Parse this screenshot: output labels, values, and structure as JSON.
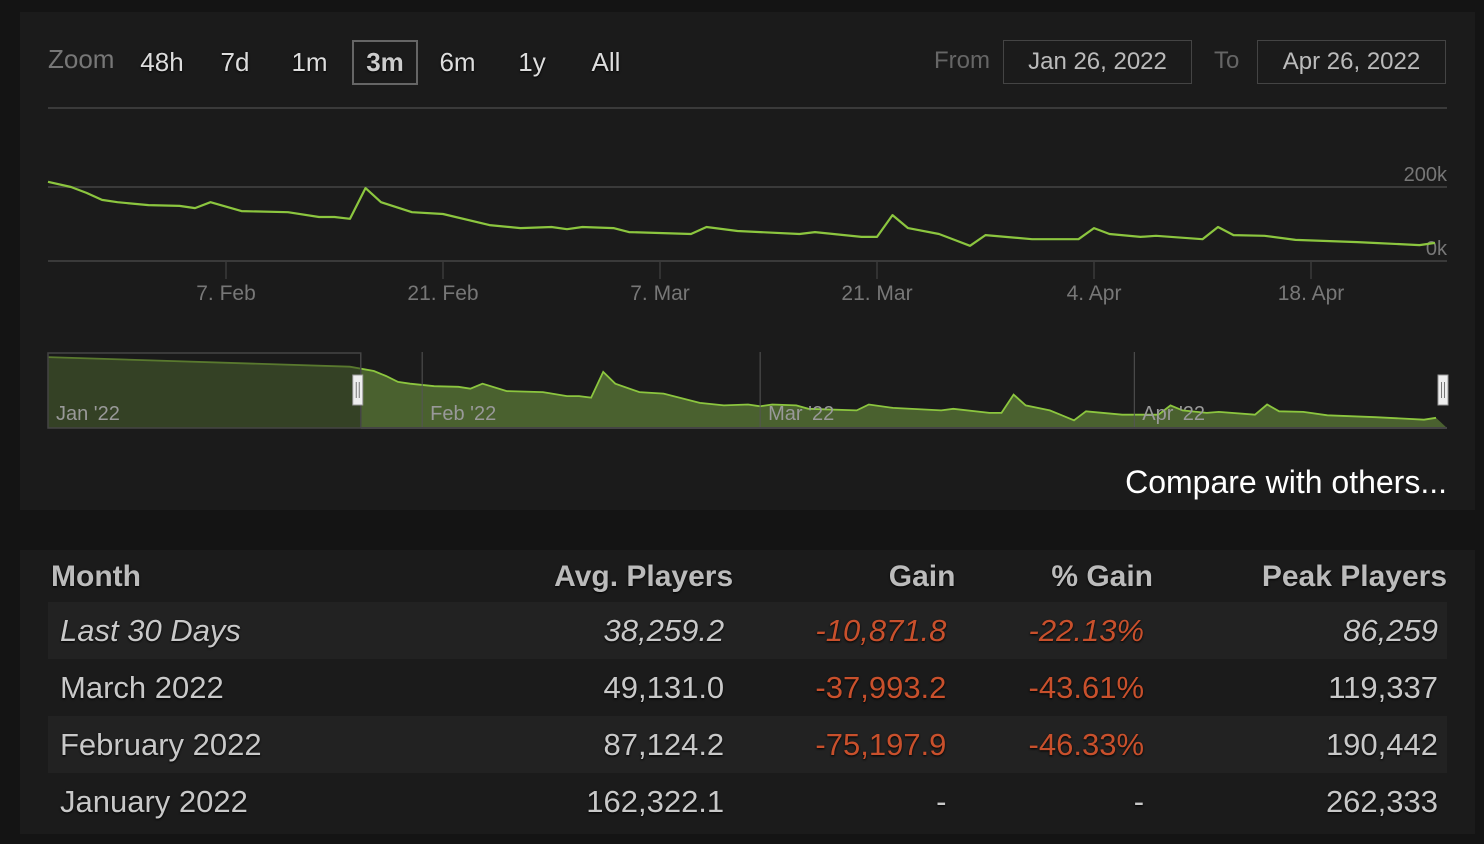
{
  "toolbar": {
    "zoom_label": "Zoom",
    "ranges": [
      "48h",
      "7d",
      "1m",
      "3m",
      "6m",
      "1y",
      "All"
    ],
    "selected_range": "3m",
    "from_label": "From",
    "from_value": "Jan 26, 2022",
    "to_label": "To",
    "to_value": "Apr 26, 2022"
  },
  "compare_link": "Compare with others...",
  "colors": {
    "line": "#8cc63f",
    "area": "#4a612f",
    "area_masked": "#2e3a22",
    "negative": "#c8502c"
  },
  "chart_data": {
    "type": "line",
    "title": "",
    "xlabel": "",
    "ylabel": "",
    "x_range": [
      "2022-01-26",
      "2022-04-26"
    ],
    "ylim": [
      0,
      200000
    ],
    "y_ticks": [
      {
        "value": 200000,
        "label": "200k"
      },
      {
        "value": 0,
        "label": "0k"
      }
    ],
    "x_ticks": [
      {
        "date": "2022-02-07",
        "label": "7. Feb"
      },
      {
        "date": "2022-02-21",
        "label": "21. Feb"
      },
      {
        "date": "2022-03-07",
        "label": "7. Mar"
      },
      {
        "date": "2022-03-21",
        "label": "21. Mar"
      },
      {
        "date": "2022-04-04",
        "label": "4. Apr"
      },
      {
        "date": "2022-04-18",
        "label": "18. Apr"
      }
    ],
    "grid": true,
    "series": [
      {
        "values": [
          [
            "2022-01-26",
            214000
          ],
          [
            "2022-01-28",
            200000
          ],
          [
            "2022-01-29",
            184000
          ],
          [
            "2022-01-30",
            165000
          ],
          [
            "2022-01-31",
            159000
          ],
          [
            "2022-02-02",
            151000
          ],
          [
            "2022-02-04",
            149000
          ],
          [
            "2022-02-05",
            143000
          ],
          [
            "2022-02-06",
            159000
          ],
          [
            "2022-02-08",
            135000
          ],
          [
            "2022-02-11",
            132000
          ],
          [
            "2022-02-13",
            119000
          ],
          [
            "2022-02-14",
            119000
          ],
          [
            "2022-02-15",
            114000
          ],
          [
            "2022-02-16",
            197000
          ],
          [
            "2022-02-17",
            159000
          ],
          [
            "2022-02-19",
            132000
          ],
          [
            "2022-02-21",
            127000
          ],
          [
            "2022-02-24",
            97000
          ],
          [
            "2022-02-26",
            89000
          ],
          [
            "2022-02-28",
            92000
          ],
          [
            "2022-03-01",
            86000
          ],
          [
            "2022-03-02",
            92000
          ],
          [
            "2022-03-04",
            89000
          ],
          [
            "2022-03-05",
            78000
          ],
          [
            "2022-03-09",
            73000
          ],
          [
            "2022-03-10",
            92000
          ],
          [
            "2022-03-12",
            81000
          ],
          [
            "2022-03-16",
            73000
          ],
          [
            "2022-03-17",
            78000
          ],
          [
            "2022-03-20",
            65000
          ],
          [
            "2022-03-21",
            65000
          ],
          [
            "2022-03-22",
            124000
          ],
          [
            "2022-03-23",
            89000
          ],
          [
            "2022-03-25",
            73000
          ],
          [
            "2022-03-26",
            57000
          ],
          [
            "2022-03-27",
            41000
          ],
          [
            "2022-03-28",
            70000
          ],
          [
            "2022-03-31",
            59000
          ],
          [
            "2022-04-03",
            59000
          ],
          [
            "2022-04-04",
            89000
          ],
          [
            "2022-04-05",
            73000
          ],
          [
            "2022-04-07",
            65000
          ],
          [
            "2022-04-08",
            68000
          ],
          [
            "2022-04-11",
            59000
          ],
          [
            "2022-04-12",
            92000
          ],
          [
            "2022-04-13",
            70000
          ],
          [
            "2022-04-15",
            68000
          ],
          [
            "2022-04-17",
            57000
          ],
          [
            "2022-04-21",
            51000
          ],
          [
            "2022-04-22",
            49000
          ],
          [
            "2022-04-25",
            43000
          ],
          [
            "2022-04-26",
            49000
          ]
        ]
      }
    ],
    "navigator": {
      "x_range": [
        "2022-01-01",
        "2022-04-26"
      ],
      "start_point": [
        "2022-01-01",
        245000
      ],
      "selection": [
        "2022-01-26",
        "2022-04-26"
      ],
      "month_labels": [
        {
          "date": "2022-01-01",
          "label": "Jan '22"
        },
        {
          "date": "2022-02-01",
          "label": "Feb '22"
        },
        {
          "date": "2022-03-01",
          "label": "Mar '22"
        },
        {
          "date": "2022-04-01",
          "label": "Apr '22"
        }
      ]
    }
  },
  "table": {
    "headers": [
      "Month",
      "Avg. Players",
      "Gain",
      "% Gain",
      "Peak Players"
    ],
    "rows": [
      {
        "month": "Last 30 Days",
        "avg": "38,259.2",
        "gain": "-10,871.8",
        "pct": "-22.13%",
        "peak": "86,259"
      },
      {
        "month": "March 2022",
        "avg": "49,131.0",
        "gain": "-37,993.2",
        "pct": "-43.61%",
        "peak": "119,337"
      },
      {
        "month": "February 2022",
        "avg": "87,124.2",
        "gain": "-75,197.9",
        "pct": "-46.33%",
        "peak": "190,442"
      },
      {
        "month": "January 2022",
        "avg": "162,322.1",
        "gain": "-",
        "pct": "-",
        "peak": "262,333"
      }
    ]
  }
}
